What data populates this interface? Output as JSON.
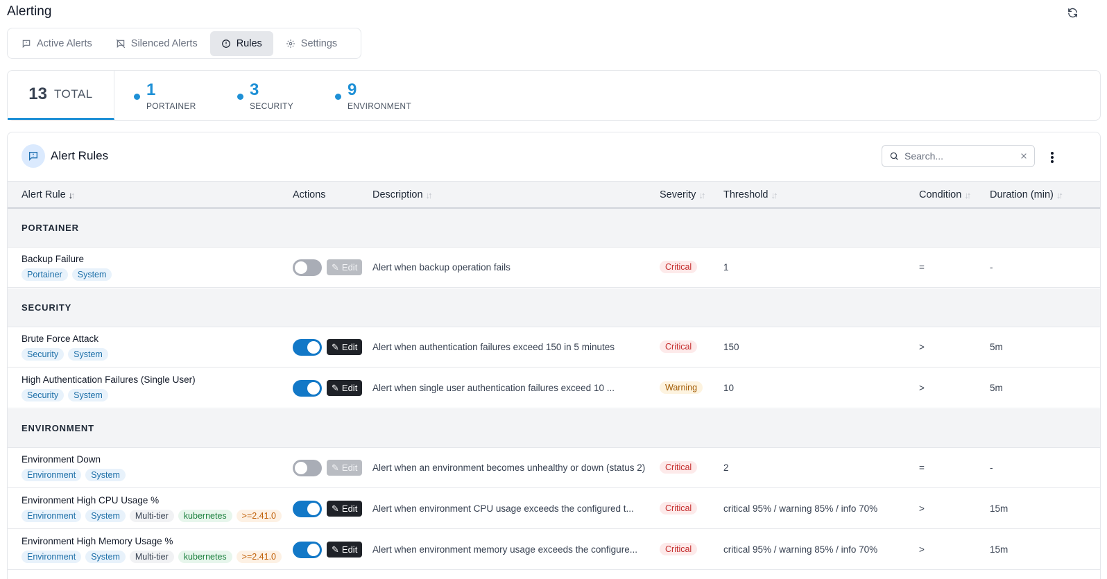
{
  "page": {
    "title": "Alerting"
  },
  "tabs": [
    {
      "label": "Active Alerts",
      "icon": "message-alert-icon"
    },
    {
      "label": "Silenced Alerts",
      "icon": "message-off-icon"
    },
    {
      "label": "Rules",
      "icon": "info-circle-icon",
      "active": true
    },
    {
      "label": "Settings",
      "icon": "gear-icon"
    }
  ],
  "summary": {
    "total": {
      "count": "13",
      "label": "TOTAL"
    },
    "stats": [
      {
        "count": "1",
        "label": "PORTAINER"
      },
      {
        "count": "3",
        "label": "SECURITY"
      },
      {
        "count": "9",
        "label": "ENVIRONMENT"
      }
    ]
  },
  "card": {
    "title": "Alert Rules",
    "search_placeholder": "Search..."
  },
  "columns": {
    "rule": "Alert Rule",
    "actions": "Actions",
    "description": "Description",
    "severity": "Severity",
    "threshold": "Threshold",
    "condition": "Condition",
    "duration": "Duration (min)"
  },
  "groups": {
    "portainer": "PORTAINER",
    "security": "SECURITY",
    "environment": "ENVIRONMENT"
  },
  "edit_label": "Edit",
  "rows": [
    {
      "name": "Backup Failure",
      "tags": [
        "Portainer",
        "System"
      ],
      "enabled": false,
      "description": "Alert when backup operation fails",
      "severity": "Critical",
      "threshold": "1",
      "condition": "=",
      "duration": "-"
    },
    {
      "name": "Brute Force Attack",
      "tags": [
        "Security",
        "System"
      ],
      "enabled": true,
      "description": "Alert when authentication failures exceed 150 in 5 minutes",
      "severity": "Critical",
      "threshold": "150",
      "condition": ">",
      "duration": "5m"
    },
    {
      "name": "High Authentication Failures (Single User)",
      "tags": [
        "Security",
        "System"
      ],
      "enabled": true,
      "description": "Alert when single user authentication failures exceed 10 ...",
      "severity": "Warning",
      "threshold": "10",
      "condition": ">",
      "duration": "5m"
    },
    {
      "name": "Environment Down",
      "tags": [
        "Environment",
        "System"
      ],
      "enabled": false,
      "description": "Alert when an environment becomes unhealthy or down (status 2)",
      "severity": "Critical",
      "threshold": "2",
      "condition": "=",
      "duration": "-"
    },
    {
      "name": "Environment High CPU Usage %",
      "tags": [
        "Environment",
        "System",
        "Multi-tier",
        "kubernetes",
        ">=2.41.0"
      ],
      "enabled": true,
      "description": "Alert when environment CPU usage exceeds the configured t...",
      "severity": "Critical",
      "threshold": "critical 95% / warning 85% / info 70%",
      "condition": ">",
      "duration": "15m"
    },
    {
      "name": "Environment High Memory Usage %",
      "tags": [
        "Environment",
        "System",
        "Multi-tier",
        "kubernetes",
        ">=2.41.0"
      ],
      "enabled": true,
      "description": "Alert when environment memory usage exceeds the configure...",
      "severity": "Critical",
      "threshold": "critical 95% / warning 85% / info 70%",
      "condition": ">",
      "duration": "15m"
    }
  ]
}
